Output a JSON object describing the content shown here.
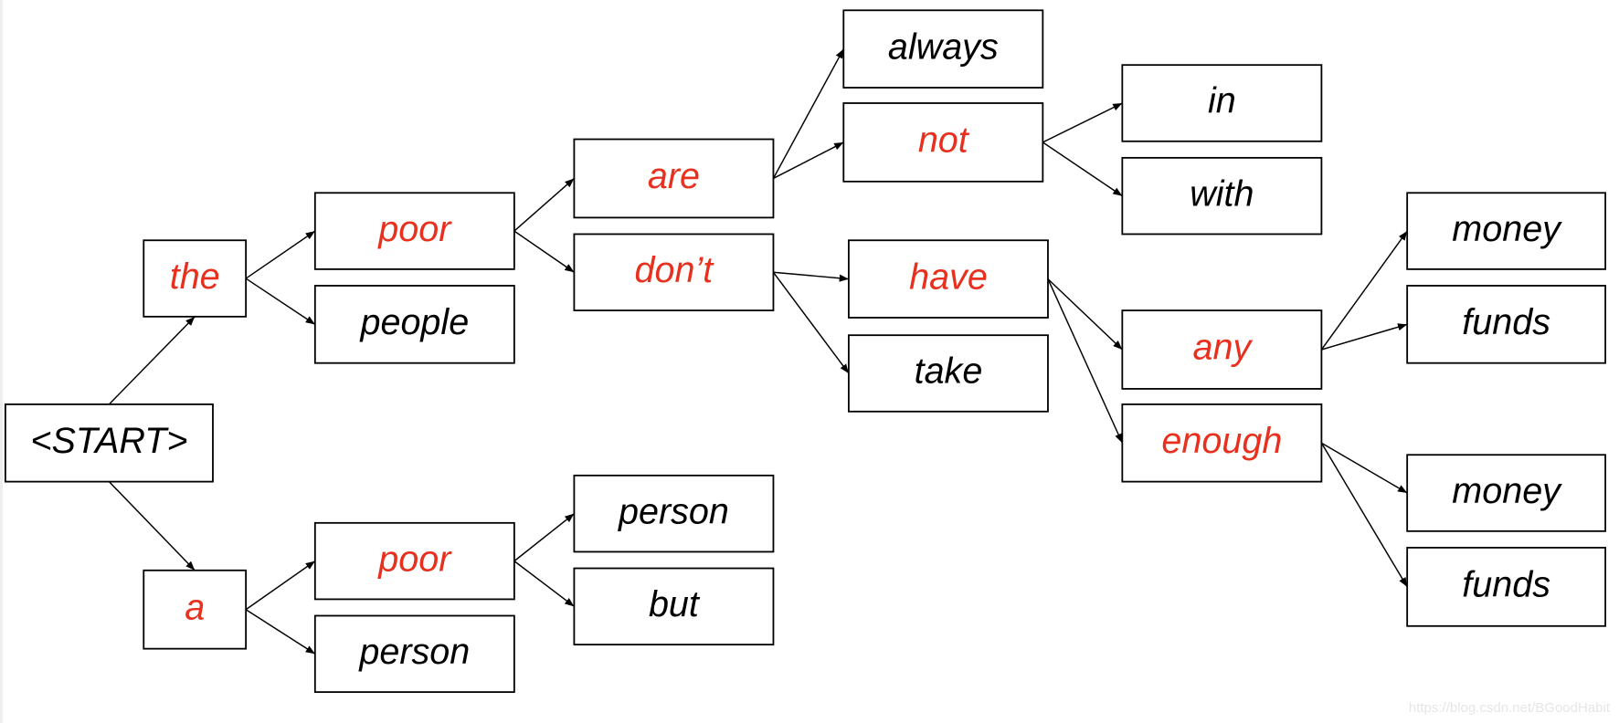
{
  "colors": {
    "highlight": "#e8301f",
    "normal": "#000000"
  },
  "nodes": [
    {
      "id": "start",
      "label": "<START>",
      "highlight": false
    },
    {
      "id": "the",
      "label": "the",
      "highlight": true
    },
    {
      "id": "a",
      "label": "a",
      "highlight": true
    },
    {
      "id": "poor1",
      "label": "poor",
      "highlight": true
    },
    {
      "id": "people",
      "label": "people",
      "highlight": false
    },
    {
      "id": "poor2",
      "label": "poor",
      "highlight": true
    },
    {
      "id": "person1",
      "label": "person",
      "highlight": false
    },
    {
      "id": "are",
      "label": "are",
      "highlight": true
    },
    {
      "id": "dont",
      "label": "don’t",
      "highlight": true
    },
    {
      "id": "person2",
      "label": "person",
      "highlight": false
    },
    {
      "id": "but",
      "label": "but",
      "highlight": false
    },
    {
      "id": "always",
      "label": "always",
      "highlight": false
    },
    {
      "id": "not",
      "label": "not",
      "highlight": true
    },
    {
      "id": "have",
      "label": "have",
      "highlight": true
    },
    {
      "id": "take",
      "label": "take",
      "highlight": false
    },
    {
      "id": "in",
      "label": "in",
      "highlight": false
    },
    {
      "id": "with",
      "label": "with",
      "highlight": false
    },
    {
      "id": "any",
      "label": "any",
      "highlight": true
    },
    {
      "id": "enough",
      "label": "enough",
      "highlight": true
    },
    {
      "id": "money1",
      "label": "money",
      "highlight": false
    },
    {
      "id": "funds1",
      "label": "funds",
      "highlight": false
    },
    {
      "id": "money2",
      "label": "money",
      "highlight": false
    },
    {
      "id": "funds2",
      "label": "funds",
      "highlight": false
    }
  ],
  "edges": [
    [
      "start",
      "the"
    ],
    [
      "start",
      "a"
    ],
    [
      "the",
      "poor1"
    ],
    [
      "the",
      "people"
    ],
    [
      "a",
      "poor2"
    ],
    [
      "a",
      "person1"
    ],
    [
      "poor1",
      "are"
    ],
    [
      "poor1",
      "dont"
    ],
    [
      "poor2",
      "person2"
    ],
    [
      "poor2",
      "but"
    ],
    [
      "are",
      "always"
    ],
    [
      "are",
      "not"
    ],
    [
      "dont",
      "have"
    ],
    [
      "dont",
      "take"
    ],
    [
      "not",
      "in"
    ],
    [
      "not",
      "with"
    ],
    [
      "have",
      "any"
    ],
    [
      "have",
      "enough"
    ],
    [
      "any",
      "money1"
    ],
    [
      "any",
      "funds1"
    ],
    [
      "enough",
      "money2"
    ],
    [
      "enough",
      "funds2"
    ]
  ],
  "watermark": "https://blog.csdn.net/BGoodHabit"
}
